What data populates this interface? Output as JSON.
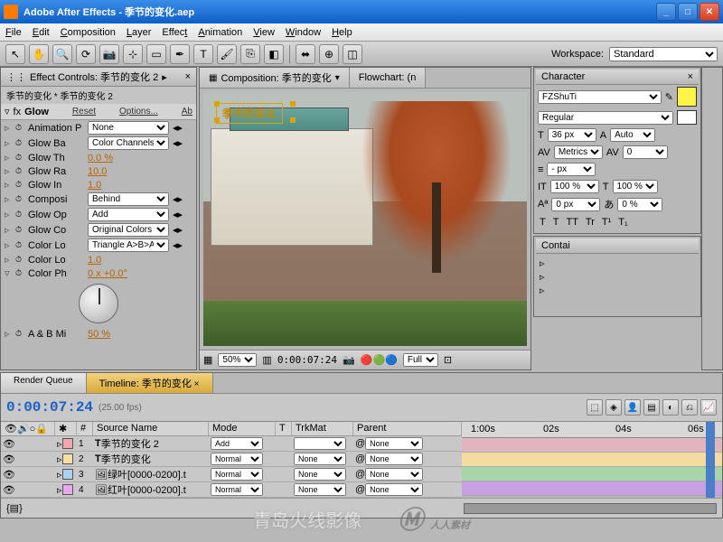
{
  "window": {
    "title": "Adobe After Effects - 季节的变化.aep"
  },
  "menu": [
    "File",
    "Edit",
    "Composition",
    "Layer",
    "Effect",
    "Animation",
    "View",
    "Window",
    "Help"
  ],
  "workspace": {
    "label": "Workspace:",
    "value": "Standard"
  },
  "effects": {
    "tab": "Effect Controls: 季节的变化 2",
    "sub": "季节的变化 * 季节的变化 2",
    "name": "Glow",
    "reset": "Reset",
    "options": "Options...",
    "ab": "Ab",
    "rows": [
      {
        "label": "Animation P",
        "type": "select",
        "value": "None"
      },
      {
        "label": "Glow Ba",
        "type": "select",
        "value": "Color Channels"
      },
      {
        "label": "Glow Th",
        "type": "value",
        "value": "0.0 %"
      },
      {
        "label": "Glow Ra",
        "type": "value",
        "value": "10.0"
      },
      {
        "label": "Glow In",
        "type": "value",
        "value": "1.0"
      },
      {
        "label": "Composi",
        "type": "select",
        "value": "Behind"
      },
      {
        "label": "Glow Op",
        "type": "select",
        "value": "Add"
      },
      {
        "label": "Glow Co",
        "type": "select",
        "value": "Original Colors"
      },
      {
        "label": "Color Lo",
        "type": "select",
        "value": "Triangle A>B>A"
      },
      {
        "label": "Color Lo",
        "type": "value",
        "value": "1.0"
      },
      {
        "label": "Color Ph",
        "type": "dial",
        "value": "0 x +0.0°"
      }
    ],
    "abmi": {
      "label": "A & B Mi",
      "value": "50 %"
    }
  },
  "comp": {
    "tab1": "Composition: 季节的变化",
    "tab2": "Flowchart: (n",
    "overlay_text": "季节的变化",
    "footer": {
      "zoom": "50%",
      "time": "0:00:07:24",
      "res": "Full"
    }
  },
  "character": {
    "tab": "Character",
    "font": "FZShuTi",
    "style": "Regular",
    "size": "36 px",
    "auto": "Auto",
    "kerning": "Metrics",
    "tracking": "0",
    "stroke": "- px",
    "vscale": "100 %",
    "hscale": "100 %",
    "baseline": "0 px",
    "tsume": "0 %",
    "faux": [
      "T",
      "T",
      "TT",
      "Tr",
      "T¹",
      "T₁"
    ]
  },
  "contain_tab": "Contai",
  "timeline": {
    "tabs": [
      "Render Queue",
      "Timeline: 季节的变化"
    ],
    "timecode": "0:00:07:24",
    "fps": "(25.00 fps)",
    "cols": {
      "num": "#",
      "source": "Source Name",
      "mode": "Mode",
      "t": "T",
      "trkmat": "TrkMat",
      "parent": "Parent"
    },
    "ruler": [
      "1:00s",
      "02s",
      "04s",
      "06s"
    ],
    "layers": [
      {
        "num": "1",
        "color": "#f2a8a8",
        "icon": "T",
        "name": "季节的变化 2",
        "mode": "Add",
        "trkmat": "",
        "parent": "None",
        "track": "#e2b4c0"
      },
      {
        "num": "2",
        "color": "#f6dfa2",
        "icon": "T",
        "name": "季节的变化",
        "mode": "Normal",
        "trkmat": "None",
        "parent": "None",
        "track": "#f4dca0"
      },
      {
        "num": "3",
        "color": "#aed0f0",
        "icon": "img",
        "name": "绿叶[0000-0200].t",
        "mode": "Normal",
        "trkmat": "None",
        "parent": "None",
        "track": "#a6d6a8"
      },
      {
        "num": "4",
        "color": "#e8a8f0",
        "icon": "img",
        "name": "红叶[0000-0200].t",
        "mode": "Normal",
        "trkmat": "None",
        "parent": "None",
        "track": "#c8a0e4"
      }
    ]
  },
  "watermark": {
    "left": "青岛火线影像",
    "right": "人人素材"
  }
}
